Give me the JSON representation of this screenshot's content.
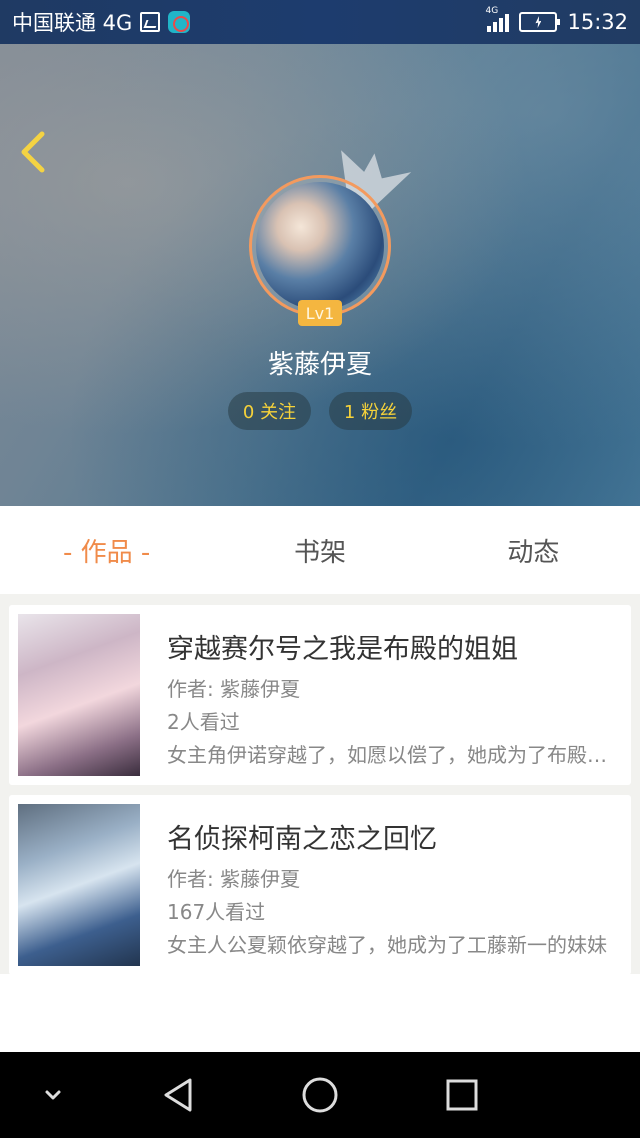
{
  "status_bar": {
    "carrier": "中国联通 4G",
    "network_small": "4G",
    "time": "15:32"
  },
  "profile": {
    "level": "Lv1",
    "username": "紫藤伊夏",
    "following": "0 关注",
    "fans": "1 粉丝"
  },
  "tabs": [
    {
      "label": "- 作品 -",
      "active": true
    },
    {
      "label": "书架",
      "active": false
    },
    {
      "label": "动态",
      "active": false
    }
  ],
  "works": [
    {
      "title": "穿越赛尔号之我是布殿的姐姐",
      "author": "作者: 紫藤伊夏",
      "views": "2人看过",
      "description": "女主角伊诺穿越了，如愿以偿了，她成为了布殿的姐姐"
    },
    {
      "title": "名侦探柯南之恋之回忆",
      "author": "作者: 紫藤伊夏",
      "views": "167人看过",
      "description": "女主人公夏颖依穿越了，她成为了工藤新一的妹妹"
    }
  ],
  "colors": {
    "accent": "#f08b4a",
    "pill_text": "#f6d23a",
    "level_badge": "#f4b640"
  }
}
